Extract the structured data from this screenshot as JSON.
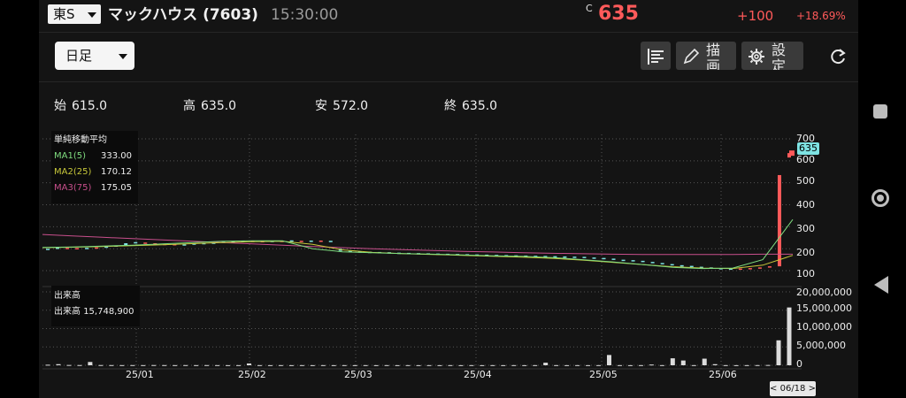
{
  "header": {
    "market": "東S",
    "name": "マックハウス (7603)",
    "time": "15:30:00",
    "price_flag": "C",
    "price": "635",
    "change": "+100",
    "change_pct": "+18.69%"
  },
  "toolbar": {
    "period": "日足",
    "draw_label": "描画",
    "settings_label": "設定"
  },
  "ohlc": {
    "open_label": "始",
    "open": "615.0",
    "high_label": "高",
    "high": "635.0",
    "low_label": "安",
    "low": "572.0",
    "close_label": "終",
    "close": "635.0"
  },
  "legend": {
    "title": "単純移動平均",
    "ma1_label": "MA1(5)",
    "ma1_value": "333.00",
    "ma2_label": "MA2(25)",
    "ma2_value": "170.12",
    "ma3_label": "MA3(75)",
    "ma3_value": "175.05"
  },
  "volume_legend": {
    "title": "出来高",
    "label": "出来高",
    "value": "15,748,900"
  },
  "price_tag": "635",
  "date_tag": "< 06/18 >",
  "colors": {
    "up": "#ff5a5a",
    "down": "#7ee3e3",
    "ma1": "#7fdc7f",
    "ma2": "#c8c83a",
    "ma3": "#c84f8c"
  },
  "chart_data": {
    "type": "candlestick",
    "x_ticks": [
      "25/01",
      "25/02",
      "25/03",
      "25/04",
      "25/05",
      "25/06"
    ],
    "y_ticks": [
      "700",
      "600",
      "500",
      "400",
      "300",
      "200",
      "100"
    ],
    "volume_ticks": [
      "20,000,000",
      "15,000,000",
      "10,000,000",
      "5,000,000",
      "0"
    ],
    "ylim": [
      60,
      720
    ],
    "volume_ylim": [
      0,
      20000000
    ],
    "price_series": [
      [
        200,
        198
      ],
      [
        205,
        201
      ],
      [
        203,
        204
      ],
      [
        200,
        203
      ],
      [
        204,
        202
      ],
      [
        202,
        206
      ],
      [
        210,
        205
      ],
      [
        215,
        210
      ],
      [
        225,
        214
      ],
      [
        230,
        228
      ],
      [
        226,
        228
      ],
      [
        222,
        225
      ],
      [
        220,
        222
      ],
      [
        218,
        221
      ],
      [
        220,
        217
      ],
      [
        224,
        219
      ],
      [
        226,
        223
      ],
      [
        228,
        225
      ],
      [
        232,
        226
      ],
      [
        234,
        230
      ],
      [
        236,
        233
      ],
      [
        235,
        236
      ],
      [
        234,
        235
      ],
      [
        236,
        233
      ],
      [
        235,
        236
      ],
      [
        238,
        234
      ],
      [
        236,
        236
      ],
      [
        237,
        236
      ],
      [
        236,
        237
      ],
      [
        236,
        235
      ],
      [
        200,
        190
      ],
      [
        190,
        188
      ],
      [
        188,
        186
      ],
      [
        186,
        185
      ],
      [
        185,
        184
      ],
      [
        184,
        182
      ],
      [
        182,
        181
      ],
      [
        181,
        180
      ],
      [
        180,
        179
      ],
      [
        179,
        178
      ],
      [
        178,
        177
      ],
      [
        177,
        176
      ],
      [
        176,
        175
      ],
      [
        175,
        174
      ],
      [
        174,
        173
      ],
      [
        173,
        172
      ],
      [
        172,
        171
      ],
      [
        171,
        170
      ],
      [
        170,
        169
      ],
      [
        169,
        168
      ],
      [
        168,
        167
      ],
      [
        167,
        166
      ],
      [
        166,
        165
      ],
      [
        165,
        164
      ],
      [
        164,
        163
      ],
      [
        163,
        160
      ],
      [
        160,
        158
      ],
      [
        158,
        155
      ],
      [
        155,
        150
      ],
      [
        150,
        148
      ],
      [
        148,
        145
      ],
      [
        145,
        140
      ],
      [
        140,
        135
      ],
      [
        135,
        130
      ],
      [
        130,
        125
      ],
      [
        125,
        122
      ],
      [
        122,
        118
      ],
      [
        118,
        115
      ],
      [
        115,
        112
      ],
      [
        112,
        110
      ],
      [
        110,
        108
      ],
      [
        108,
        110
      ],
      [
        110,
        112
      ],
      [
        112,
        115
      ],
      [
        115,
        120
      ],
      [
        120,
        535
      ],
      [
        615,
        635
      ]
    ],
    "ma1": [
      206,
      208,
      212,
      216,
      222,
      228,
      234,
      236,
      236,
      200,
      186,
      182,
      178,
      175,
      172,
      168,
      165,
      160,
      150,
      140,
      128,
      115,
      110,
      112,
      150,
      333
    ],
    "ma2": [
      205,
      207,
      210,
      214,
      218,
      223,
      228,
      232,
      234,
      220,
      195,
      183,
      178,
      174,
      170,
      166,
      162,
      156,
      148,
      138,
      128,
      118,
      112,
      110,
      125,
      170
    ],
    "ma3": [
      265,
      258,
      252,
      246,
      240,
      234,
      228,
      222,
      216,
      210,
      205,
      200,
      196,
      192,
      188,
      185,
      182,
      179,
      177,
      175,
      174,
      174,
      174,
      174,
      175,
      175
    ],
    "volumes": [
      150000,
      300000,
      80000,
      60000,
      900000,
      60000,
      50000,
      40000,
      50000,
      40000,
      60000,
      50000,
      40000,
      50000,
      40000,
      50000,
      40000,
      30000,
      40000,
      500000,
      40000,
      30000,
      40000,
      30000,
      40000,
      30000,
      40000,
      30000,
      40000,
      30000,
      40000,
      30000,
      40000,
      30000,
      40000,
      30000,
      40000,
      30000,
      40000,
      30000,
      40000,
      30000,
      40000,
      30000,
      40000,
      30000,
      40000,
      700000,
      40000,
      30000,
      40000,
      30000,
      40000,
      2800000,
      40000,
      30000,
      40000,
      200000,
      40000,
      1900000,
      1300000,
      40000,
      1800000,
      300000,
      40000,
      30000,
      40000,
      50000,
      80000,
      6800000,
      15748900
    ]
  }
}
